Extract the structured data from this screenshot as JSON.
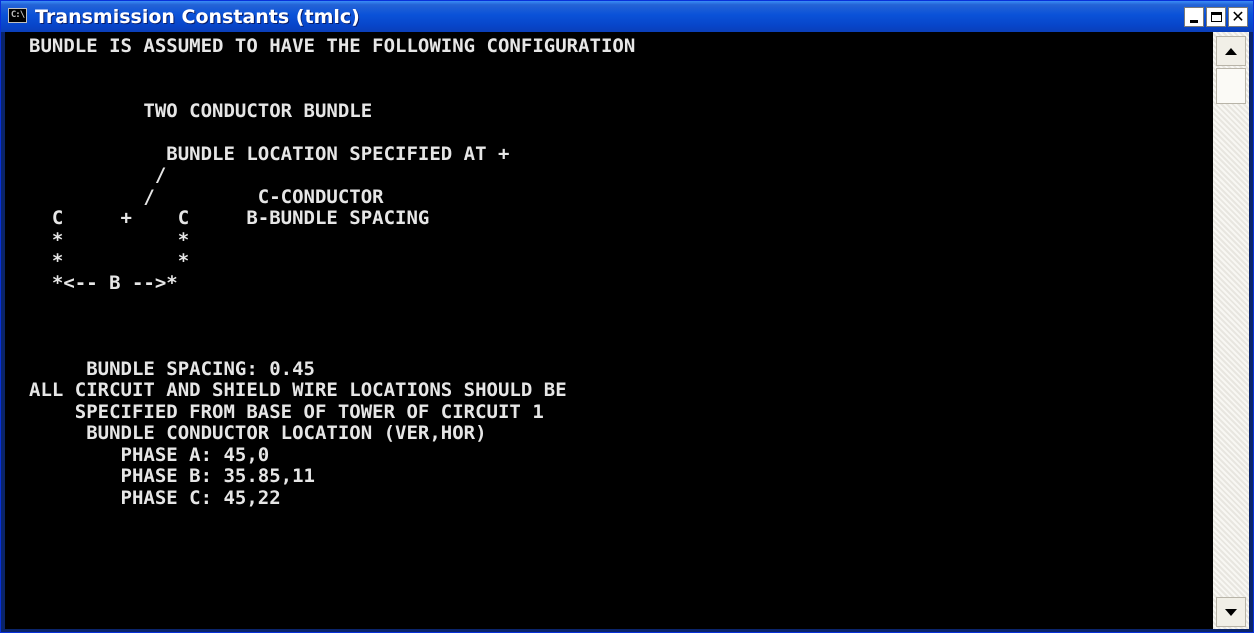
{
  "window": {
    "title": "Transmission Constants (tmlc)",
    "icon": "console-icon",
    "icon_glyph": "C:\\",
    "controls": {
      "minimize": "minimize-icon",
      "maximize": "maximize-icon",
      "close": "close-icon"
    }
  },
  "console": {
    "lines": [
      "BUNDLE IS ASSUMED TO HAVE THE FOLLOWING CONFIGURATION",
      "",
      "",
      "          TWO CONDUCTOR BUNDLE",
      "",
      "            BUNDLE LOCATION SPECIFIED AT +",
      "           /",
      "          /         C-CONDUCTOR",
      "  C     +    C     B-BUNDLE SPACING",
      "  *          *",
      "  *          *",
      "  *<-- B -->*",
      "",
      "",
      "",
      "     BUNDLE SPACING: 0.45",
      "ALL CIRCUIT AND SHIELD WIRE LOCATIONS SHOULD BE",
      "    SPECIFIED FROM BASE OF TOWER OF CIRCUIT 1",
      "     BUNDLE CONDUCTOR LOCATION (VER,HOR)",
      "        PHASE A: 45,0",
      "        PHASE B: 35.85,11",
      "        PHASE C: 45,22"
    ]
  },
  "colors": {
    "console_bg": "#000000",
    "console_text": "#e6e6e6",
    "titlebar": "#0a52d8"
  }
}
